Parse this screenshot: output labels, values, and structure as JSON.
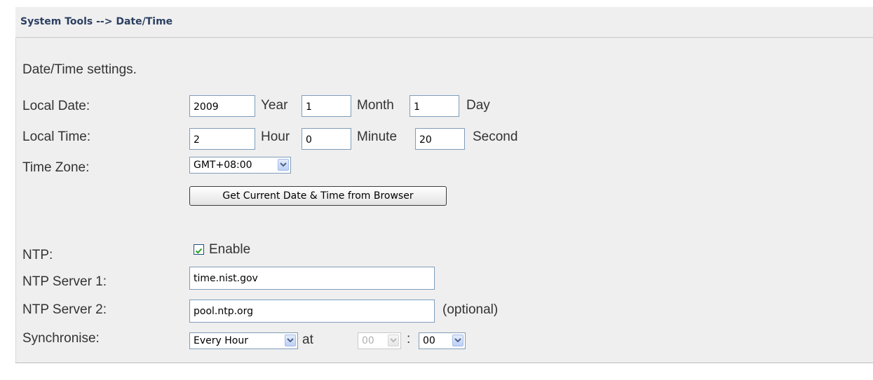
{
  "breadcrumb": "System Tools --> Date/Time",
  "intro": "Date/Time settings.",
  "local_date": {
    "label": "Local Date:",
    "year_value": "2009",
    "year_unit": "Year",
    "month_value": "1",
    "month_unit": "Month",
    "day_value": "1",
    "day_unit": "Day"
  },
  "local_time": {
    "label": "Local Time:",
    "hour_value": "2",
    "hour_unit": "Hour",
    "minute_value": "0",
    "minute_unit": "Minute",
    "second_value": "20",
    "second_unit": "Second"
  },
  "time_zone": {
    "label": "Time Zone:",
    "selected": "GMT+08:00"
  },
  "browser_button": "Get Current Date & Time from Browser",
  "ntp": {
    "label": "NTP:",
    "enable_label": "Enable",
    "enabled": true
  },
  "ntp_server_1": {
    "label": "NTP Server 1:",
    "value": "time.nist.gov"
  },
  "ntp_server_2": {
    "label": "NTP Server 2:",
    "value": "pool.ntp.org",
    "note": "(optional)"
  },
  "synchronise": {
    "label": "Synchronise:",
    "frequency": "Every Hour",
    "at_label": "at",
    "hour_selected": "00",
    "hour_disabled": true,
    "separator": ":",
    "minute_selected": "00"
  },
  "icons": {
    "dropdown": "chevron-down-icon",
    "checkbox": "checkmark-icon"
  },
  "colors": {
    "breadcrumb": "#2b3f62",
    "panel": "#efefef",
    "checkmark": "#21a121"
  }
}
